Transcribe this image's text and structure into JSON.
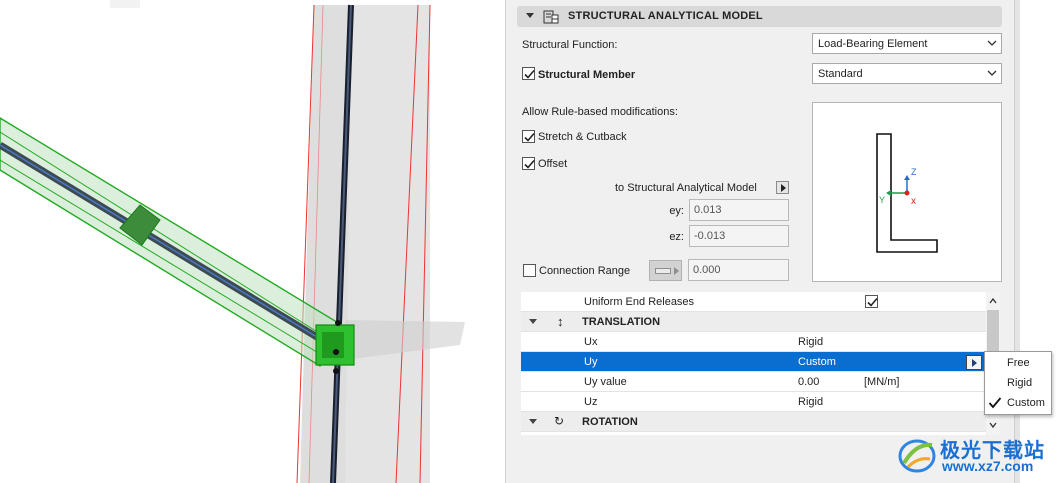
{
  "panel": {
    "section_title": "STRUCTURAL ANALYTICAL MODEL",
    "structural_function_label": "Structural Function:",
    "structural_function_value": "Load-Bearing Element",
    "structural_member_label": "Structural Member",
    "structural_member_checked": true,
    "structural_member_value": "Standard",
    "allow_rule_label": "Allow Rule-based modifications:",
    "stretch_label": "Stretch & Cutback",
    "stretch_checked": true,
    "offset_label": "Offset",
    "offset_checked": true,
    "to_model_label": "to Structural Analytical Model",
    "ey_label": "ey:",
    "ey_value": "0.013",
    "ez_label": "ez:",
    "ez_value": "-0.013",
    "connection_range_label": "Connection Range",
    "connection_range_checked": false,
    "connection_range_value": "0.000"
  },
  "preview_axes": {
    "z": "Z",
    "y": "Y",
    "x": "x"
  },
  "grid": {
    "uniform_label": "Uniform End Releases",
    "uniform_checked": true,
    "translation_label": "TRANSLATION",
    "rows": [
      {
        "name": "Ux",
        "value": "Rigid",
        "unit": ""
      },
      {
        "name": "Uy",
        "value": "Custom",
        "unit": ""
      },
      {
        "name": "Uy value",
        "value": "0.00",
        "unit": "[MN/m]"
      },
      {
        "name": "Uz",
        "value": "Rigid",
        "unit": ""
      }
    ],
    "rotation_label": "ROTATION"
  },
  "dropdown": {
    "options": [
      "Free",
      "Rigid",
      "Custom"
    ],
    "selected": "Custom"
  },
  "watermark": {
    "name": "极光下载站",
    "url": "www.xz7.com"
  },
  "colors": {
    "selection": "#0a6ed1",
    "beam_green": "#2db52d"
  }
}
